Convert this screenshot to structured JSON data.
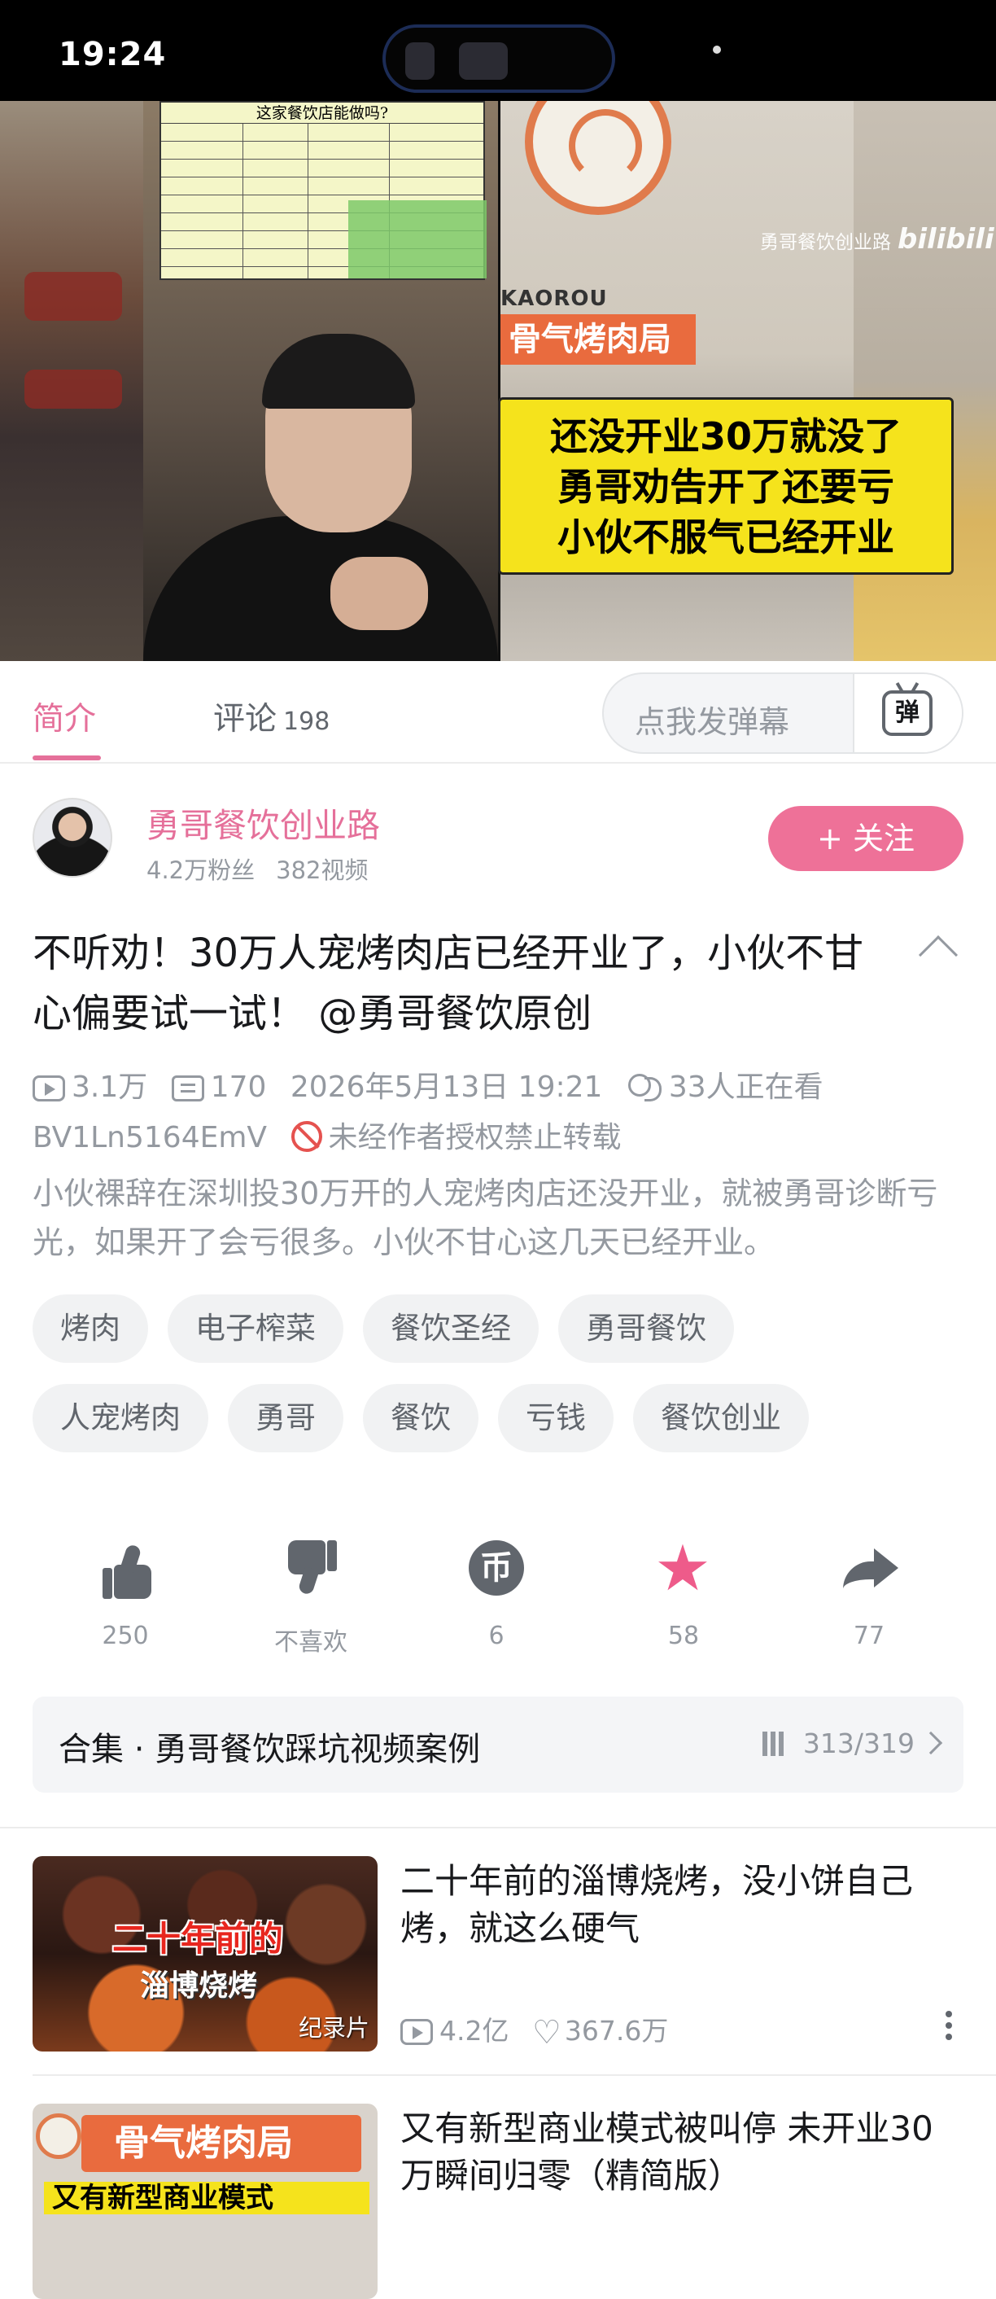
{
  "status_bar": {
    "time": "19:24"
  },
  "video": {
    "watermark": "勇哥餐饮创业路",
    "watermark_brand": "bilibili",
    "table_title": "这家餐饮店能做吗?",
    "shop_sign": "骨气烤肉局",
    "shop_sign_en": "KAOROU",
    "overlay_lines": [
      "还没开业30万就没了",
      "勇哥劝告开了还要亏",
      "小伙不服气已经开业"
    ]
  },
  "tabs": {
    "intro": "简介",
    "comments": "评论",
    "comments_count": "198",
    "danmaku_placeholder": "点我发弹幕",
    "danmaku_button": "弹"
  },
  "uploader": {
    "name": "勇哥餐饮创业路",
    "fans": "4.2万粉丝",
    "videos": "382视频",
    "follow_label": "+ 关注"
  },
  "video_info": {
    "title": "不听劝！30万人宠烤肉店已经开业了，小伙不甘心偏要试一试！ @勇哥餐饮原创",
    "views": "3.1万",
    "danmaku_count": "170",
    "date": "2026年5月13日 19:21",
    "watching": "33人正在看",
    "bvid": "BV1Ln5164EmV",
    "copyright": "未经作者授权禁止转载",
    "description": "小伙裸辞在深圳投30万开的人宠烤肉店还没开业，就被勇哥诊断亏光，如果开了会亏很多。小伙不甘心这几天已经开业。"
  },
  "tags": {
    "row1": [
      "烤肉",
      "电子榨菜",
      "餐饮圣经",
      "勇哥餐饮"
    ],
    "row2": [
      "人宠烤肉",
      "勇哥",
      "餐饮",
      "亏钱",
      "餐饮创业"
    ]
  },
  "actions": {
    "like": "250",
    "dislike": "不喜欢",
    "coin": "6",
    "coin_glyph": "币",
    "favorite": "58",
    "share": "77"
  },
  "collection": {
    "label": "合集 · 勇哥餐饮踩坑视频案例",
    "progress": "313/319"
  },
  "recommendations": [
    {
      "title": "二十年前的淄博烧烤，没小饼自己烤，就这么硬气",
      "thumb_line1": "二十年前的",
      "thumb_line2": "淄博烧烤",
      "badge": "纪录片",
      "views": "4.2亿",
      "likes": "367.6万"
    },
    {
      "title": "又有新型商业模式被叫停 未开业30万瞬间归零（精简版）",
      "thumb_sign": "骨气烤肉局",
      "thumb_sub": "又有新型商业模式"
    }
  ],
  "colors": {
    "accent": "#e5709a",
    "follow_bg": "#ee7198",
    "favorite": "#ee5b8a",
    "overlay_yellow": "#f5e31c"
  }
}
